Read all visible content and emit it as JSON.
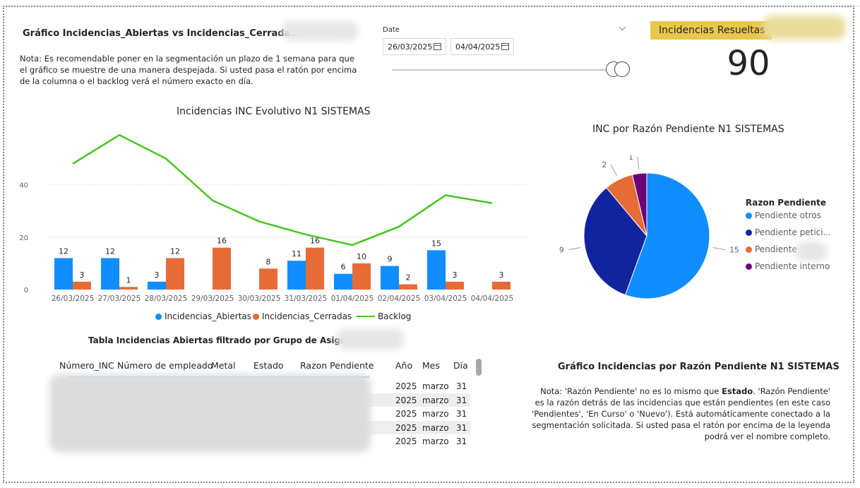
{
  "header": {
    "left_title": "Gráfico Incidencias_Abiertas vs Incidencias_Cerradas",
    "note": "Nota: Es recomendable poner en la segmentación un plazo de 1 semana para que el gráfico se muestre de una manera despejada. Si usted pasa el ratón por encima de la columna o el backlog verá el número exacto en día."
  },
  "date_slicer": {
    "label": "Date",
    "start": "26/03/2025",
    "end": "04/04/2025"
  },
  "kpi": {
    "label": "Incidencias Resueltas",
    "value": "90"
  },
  "colors": {
    "abiertas": "#118dff",
    "cerradas": "#e66c37",
    "backlog": "#45c71f",
    "otros": "#118dff",
    "peticion": "#12239e",
    "pendiente": "#e66c37",
    "interno": "#6b007b",
    "kpi_bg": "#e8c84a"
  },
  "chart_data": [
    {
      "type": "bar",
      "title": "Incidencias INC Evolutivo N1 SISTEMAS",
      "categories": [
        "26/03/2025",
        "27/03/2025",
        "28/03/2025",
        "29/03/2025",
        "30/03/2025",
        "31/03/2025",
        "01/04/2025",
        "02/04/2025",
        "03/04/2025",
        "04/04/2025"
      ],
      "series": [
        {
          "name": "Incidencias_Abiertas",
          "type": "bar",
          "values": [
            12,
            12,
            3,
            null,
            null,
            11,
            6,
            9,
            15,
            null
          ]
        },
        {
          "name": "Incidencias_Cerradas",
          "type": "bar",
          "values": [
            3,
            1,
            12,
            16,
            8,
            16,
            10,
            2,
            3,
            3
          ]
        },
        {
          "name": "Backlog",
          "type": "line",
          "values": [
            48,
            59,
            50,
            34,
            26,
            21,
            17,
            24,
            36,
            33
          ]
        }
      ],
      "ylim": [
        0,
        62
      ],
      "yticks": [
        "0",
        "20",
        "40"
      ],
      "legend": "bottom-center",
      "grid": true
    },
    {
      "type": "pie",
      "title": "INC por Razón Pendiente N1 SISTEMAS",
      "legend_title": "Razon Pendiente",
      "labels": [
        "Pendiente otros",
        "Pendiente petici...",
        "Pendiente",
        "Pendiente interno"
      ],
      "values": [
        15,
        9,
        2,
        1
      ],
      "legend": "right"
    }
  ],
  "table": {
    "title": "Tabla Incidencias Abiertas filtrado por Grupo de Asignación",
    "columns": [
      "Número_INC",
      "Número de empleado",
      "Metal",
      "Estado",
      "Razon Pendiente",
      "Año",
      "Mes",
      "Día"
    ],
    "rows": [
      [
        "2025",
        "marzo",
        "31"
      ],
      [
        "2025",
        "marzo",
        "31"
      ],
      [
        "2025",
        "marzo",
        "31"
      ],
      [
        "2025",
        "marzo",
        "31"
      ],
      [
        "2025",
        "marzo",
        "31"
      ]
    ]
  },
  "right_note": {
    "title": "Gráfico Incidencias por Razón Pendiente N1 SISTEMAS",
    "pre": "Nota: 'Razón Pendiente' no es lo mismo que ",
    "bold": "Estado",
    "post": ". 'Razón Pendiente' es la razón detrás de las incidencias que están pendientes (en este caso 'Pendientes', 'En Curso' o 'Nuevo'). Está automáticamente conectado a la segmentación solicitada. Si usted pasa el ratón por encima de la leyenda podrá ver el nombre completo."
  }
}
